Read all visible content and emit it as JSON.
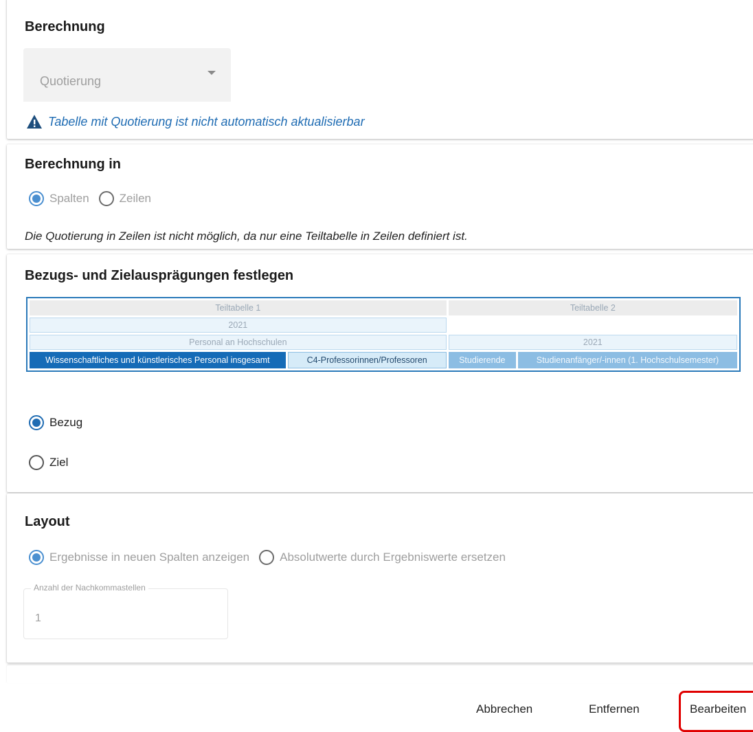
{
  "berechnung": {
    "title": "Berechnung",
    "select_value": "Quotierung",
    "warning": "Tabelle mit Quotierung ist nicht automatisch aktualisierbar"
  },
  "berechnung_in": {
    "title": "Berechnung in",
    "option_spalten": "Spalten",
    "option_zeilen": "Zeilen",
    "selected": "Spalten",
    "note": "Die Quotierung in Zeilen ist nicht möglich, da nur eine Teiltabelle in Zeilen definiert ist."
  },
  "bezug": {
    "title": "Bezugs- und Zielausprägungen festlegen",
    "table": {
      "teiltabelle_1": "Teiltabelle 1",
      "teiltabelle_2": "Teiltabelle 2",
      "year_1": "2021",
      "year_2": "2021",
      "group": "Personal an Hochschulen",
      "col_1": "Wissenschaftliches und künstlerisches Personal insgesamt",
      "col_2": "C4-Professorinnen/Professoren",
      "col_3": "Studierende",
      "col_4": "Studienanfänger/-innen (1. Hochschulsemester)"
    },
    "option_bezug": "Bezug",
    "option_ziel": "Ziel",
    "selected": "Bezug"
  },
  "layout": {
    "title": "Layout",
    "option_new_columns": "Ergebnisse in neuen Spalten anzeigen",
    "option_replace": "Absolutwerte durch Ergebniswerte ersetzen",
    "selected": "Ergebnisse in neuen Spalten anzeigen",
    "decimals_label": "Anzahl der Nachkommastellen",
    "decimals_value": "1"
  },
  "footer": {
    "cancel": "Abbrechen",
    "remove": "Entfernen",
    "edit": "Bearbeiten"
  },
  "colors": {
    "accent": "#1f6cb3",
    "selected_cell": "#156bb7",
    "highlight_border": "#e00000"
  }
}
